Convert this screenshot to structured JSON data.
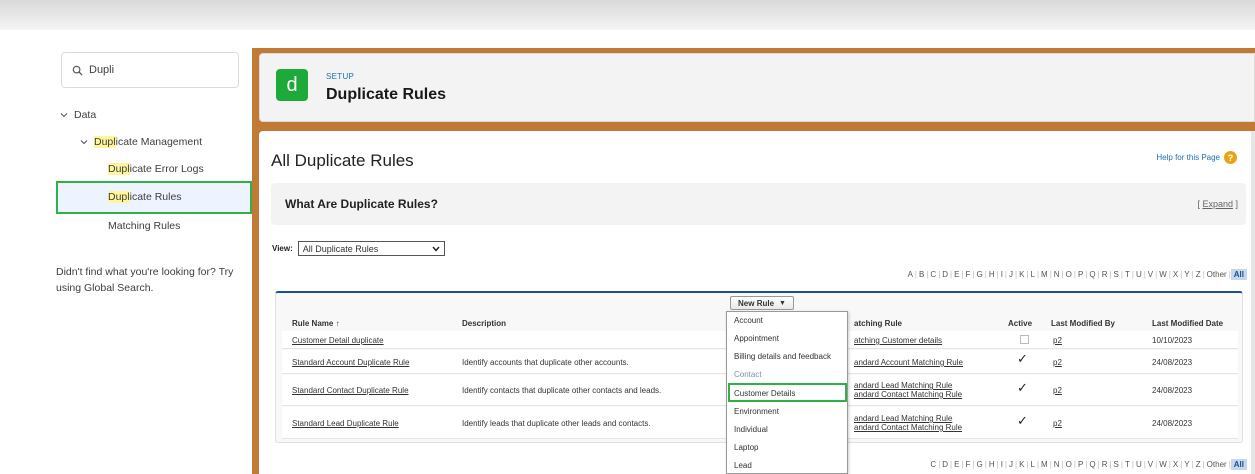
{
  "search": {
    "value": "Dupli"
  },
  "tree": {
    "data_label": "Data",
    "dup_mgmt": {
      "hl": "Dupl",
      "rest": "icate Management"
    },
    "error_logs": {
      "hl": "Dupl",
      "rest": "icate Error Logs"
    },
    "dup_rules": {
      "hl": "Dupl",
      "rest": "icate Rules"
    },
    "matching_rules": "Matching Rules"
  },
  "sidebar_hint": "Didn't find what you're looking for? Try using Global Search.",
  "header": {
    "logo_letter": "d",
    "setup_label": "SETUP",
    "title": "Duplicate Rules"
  },
  "content": {
    "heading": "All Duplicate Rules",
    "help_link": "Help for this Page",
    "what_title": "What Are Duplicate Rules?",
    "expand_open": "[ ",
    "expand_label": "Expand",
    "expand_close": " ]",
    "view_label": "View:",
    "view_value": "All Duplicate Rules"
  },
  "alphabet": [
    "A",
    "B",
    "C",
    "D",
    "E",
    "F",
    "G",
    "H",
    "I",
    "J",
    "K",
    "L",
    "M",
    "N",
    "O",
    "P",
    "Q",
    "R",
    "S",
    "T",
    "U",
    "V",
    "W",
    "X",
    "Y",
    "Z",
    "Other",
    "All"
  ],
  "alphabet_bottom": [
    "C",
    "D",
    "E",
    "F",
    "G",
    "H",
    "I",
    "J",
    "K",
    "L",
    "M",
    "N",
    "O",
    "P",
    "Q",
    "R",
    "S",
    "T",
    "U",
    "V",
    "W",
    "X",
    "Y",
    "Z",
    "Other",
    "All"
  ],
  "table": {
    "new_rule_label": "New Rule",
    "columns": {
      "rule_name": "Rule Name",
      "sort_arrow": "↑",
      "description": "Description",
      "matching_rule": "atching Rule",
      "active": "Active",
      "last_modified_by": "Last Modified By",
      "last_modified_date": "Last Modified Date"
    },
    "rows": [
      {
        "name": "Customer Detail duplicate",
        "description": "",
        "matching": [
          "atching Customer details"
        ],
        "active": false,
        "by": "p2",
        "date": "10/10/2023"
      },
      {
        "name": "Standard Account Duplicate Rule",
        "description": "Identify accounts that duplicate other accounts.",
        "matching": [
          "andard Account Matching Rule"
        ],
        "active": true,
        "by": "p2",
        "date": "24/08/2023"
      },
      {
        "name": "Standard Contact Duplicate Rule",
        "description": "Identify contacts that duplicate other contacts and leads.",
        "matching": [
          "andard Lead Matching Rule",
          "andard Contact Matching Rule"
        ],
        "active": true,
        "by": "p2",
        "date": "24/08/2023"
      },
      {
        "name": "Standard Lead Duplicate Rule",
        "description": "Identify leads that duplicate other leads and contacts.",
        "matching": [
          "andard Lead Matching Rule",
          "andard Contact Matching Rule"
        ],
        "active": true,
        "by": "p2",
        "date": "24/08/2023"
      }
    ]
  },
  "dropdown_items": [
    "Account",
    "Appointment",
    "Billing details and feedback",
    "Contact",
    "Customer Details",
    "Environment",
    "Individual",
    "Laptop",
    "Lead"
  ],
  "colors": {
    "accent_orange": "#c07a35",
    "logo_green": "#1eaa3a",
    "highlight_green": "#2fb14a",
    "link_blue": "#1e6fb5"
  }
}
